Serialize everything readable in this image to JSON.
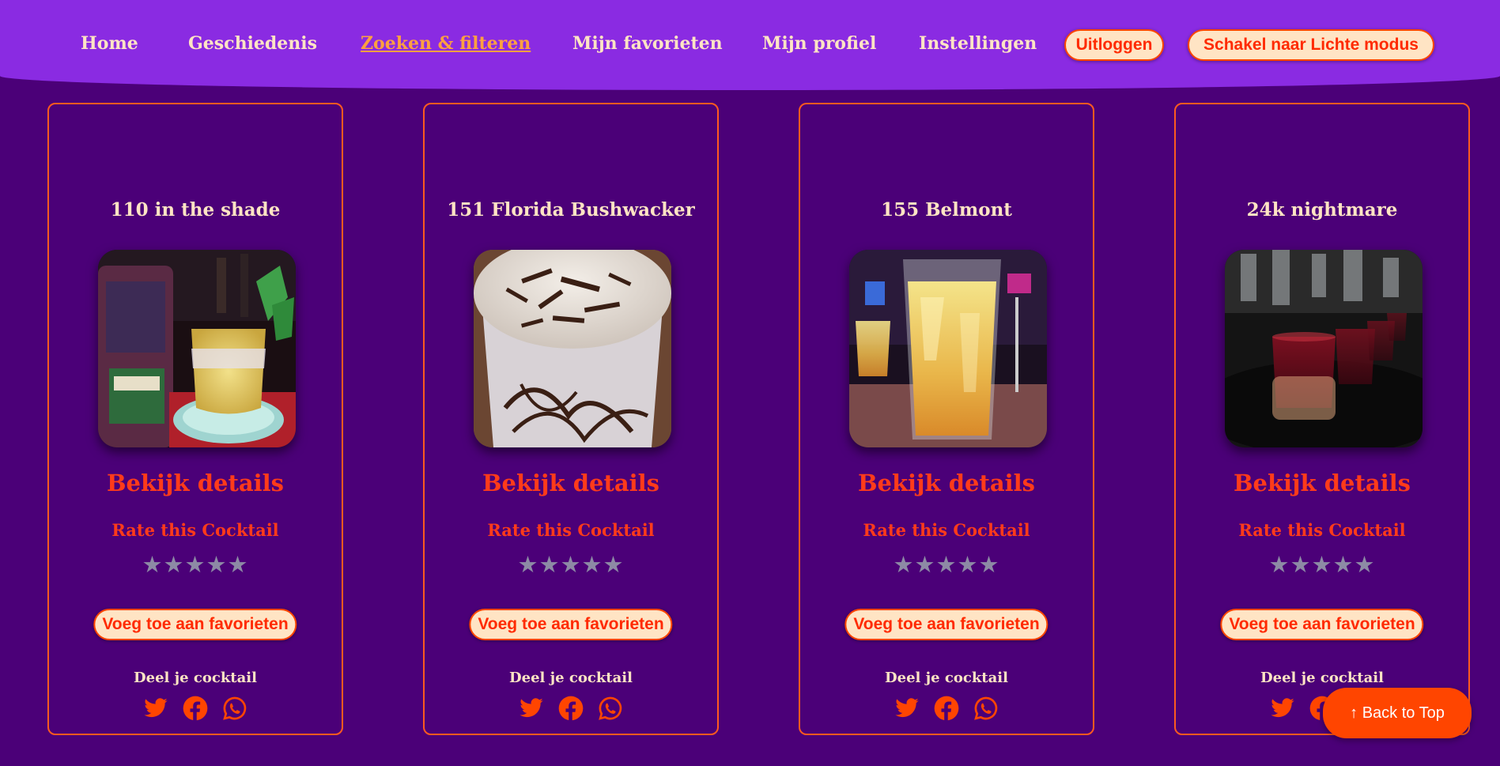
{
  "nav": {
    "links": [
      {
        "label": "Home",
        "active": false
      },
      {
        "label": "Geschiedenis",
        "active": false
      },
      {
        "label": "Zoeken & filteren",
        "active": true
      },
      {
        "label": "Mijn favorieten",
        "active": false
      },
      {
        "label": "Mijn profiel",
        "active": false
      },
      {
        "label": "Instellingen",
        "active": false
      }
    ],
    "logout_label": "Uitloggen",
    "theme_toggle_label": "Schakel naar Lichte modus"
  },
  "cards": [
    {
      "title": "110 in the shade",
      "details_label": "Bekijk details",
      "rate_label": "Rate this Cocktail",
      "stars": [
        "★",
        "★",
        "★",
        "★",
        "★"
      ],
      "rating": 0,
      "favorite_label": "Voeg toe aan favorieten",
      "share_label": "Deel je cocktail",
      "share_icons": [
        "twitter-icon",
        "facebook-icon",
        "whatsapp-icon"
      ]
    },
    {
      "title": "151 Florida Bushwacker",
      "details_label": "Bekijk details",
      "rate_label": "Rate this Cocktail",
      "stars": [
        "★",
        "★",
        "★",
        "★",
        "★"
      ],
      "rating": 0,
      "favorite_label": "Voeg toe aan favorieten",
      "share_label": "Deel je cocktail",
      "share_icons": [
        "twitter-icon",
        "facebook-icon",
        "whatsapp-icon"
      ]
    },
    {
      "title": "155 Belmont",
      "details_label": "Bekijk details",
      "rate_label": "Rate this Cocktail",
      "stars": [
        "★",
        "★",
        "★",
        "★",
        "★"
      ],
      "rating": 0,
      "favorite_label": "Voeg toe aan favorieten",
      "share_label": "Deel je cocktail",
      "share_icons": [
        "twitter-icon",
        "facebook-icon",
        "whatsapp-icon"
      ]
    },
    {
      "title": "24k nightmare",
      "details_label": "Bekijk details",
      "rate_label": "Rate this Cocktail",
      "stars": [
        "★",
        "★",
        "★",
        "★",
        "★"
      ],
      "rating": 0,
      "favorite_label": "Voeg toe aan favorieten",
      "share_label": "Deel je cocktail",
      "share_icons": [
        "twitter-icon",
        "facebook-icon",
        "whatsapp-icon"
      ]
    }
  ],
  "back_to_top_label": "↑ Back to Top",
  "colors": {
    "background": "#4b0078",
    "navbar": "#8a2be2",
    "accent": "#ff4500",
    "cream": "#ffe4c4",
    "active_link": "#ffa040",
    "star_empty": "#8d8aa5"
  }
}
